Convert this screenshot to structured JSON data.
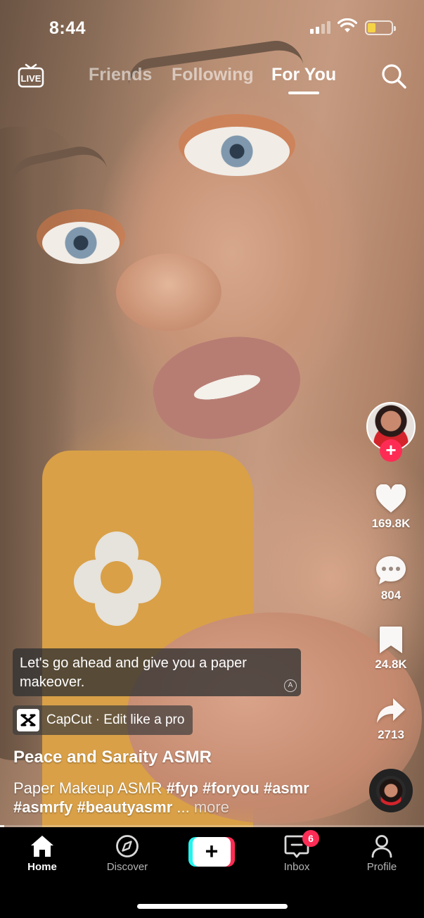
{
  "status_bar": {
    "time": "8:44",
    "battery_level": 0.35,
    "battery_color": "#f5d347"
  },
  "top_nav": {
    "live_label": "LIVE",
    "tabs": [
      {
        "label": "Friends",
        "active": false
      },
      {
        "label": "Following",
        "active": false
      },
      {
        "label": "For You",
        "active": true
      }
    ],
    "search_icon": "search-icon"
  },
  "right_rail": {
    "likes": "169.8K",
    "comments": "804",
    "saves": "24.8K",
    "shares": "2713",
    "follow_symbol": "+"
  },
  "video": {
    "subtitle": "Let's go ahead and give you a paper makeover.",
    "capcut_text": "CapCut · Edit like a pro",
    "author": "Peace and Saraity ASMR",
    "description": "Paper Makeup ASMR",
    "hashtags": [
      "#fyp",
      "#foryou",
      "#asmr",
      "#asmrfy",
      "#beautyasmr"
    ],
    "ellipsis": "...",
    "more_label": "more",
    "progress": 0.01
  },
  "bottom_nav": {
    "items": [
      {
        "label": "Home",
        "icon": "home-icon",
        "active": true
      },
      {
        "label": "Discover",
        "icon": "compass-icon",
        "active": false
      },
      {
        "label": "Inbox",
        "icon": "inbox-icon",
        "active": false,
        "badge": "6"
      },
      {
        "label": "Profile",
        "icon": "person-icon",
        "active": false
      }
    ],
    "create_symbol": "+"
  },
  "colors": {
    "accent": "#fe2c55",
    "cyan": "#25f4ee"
  }
}
